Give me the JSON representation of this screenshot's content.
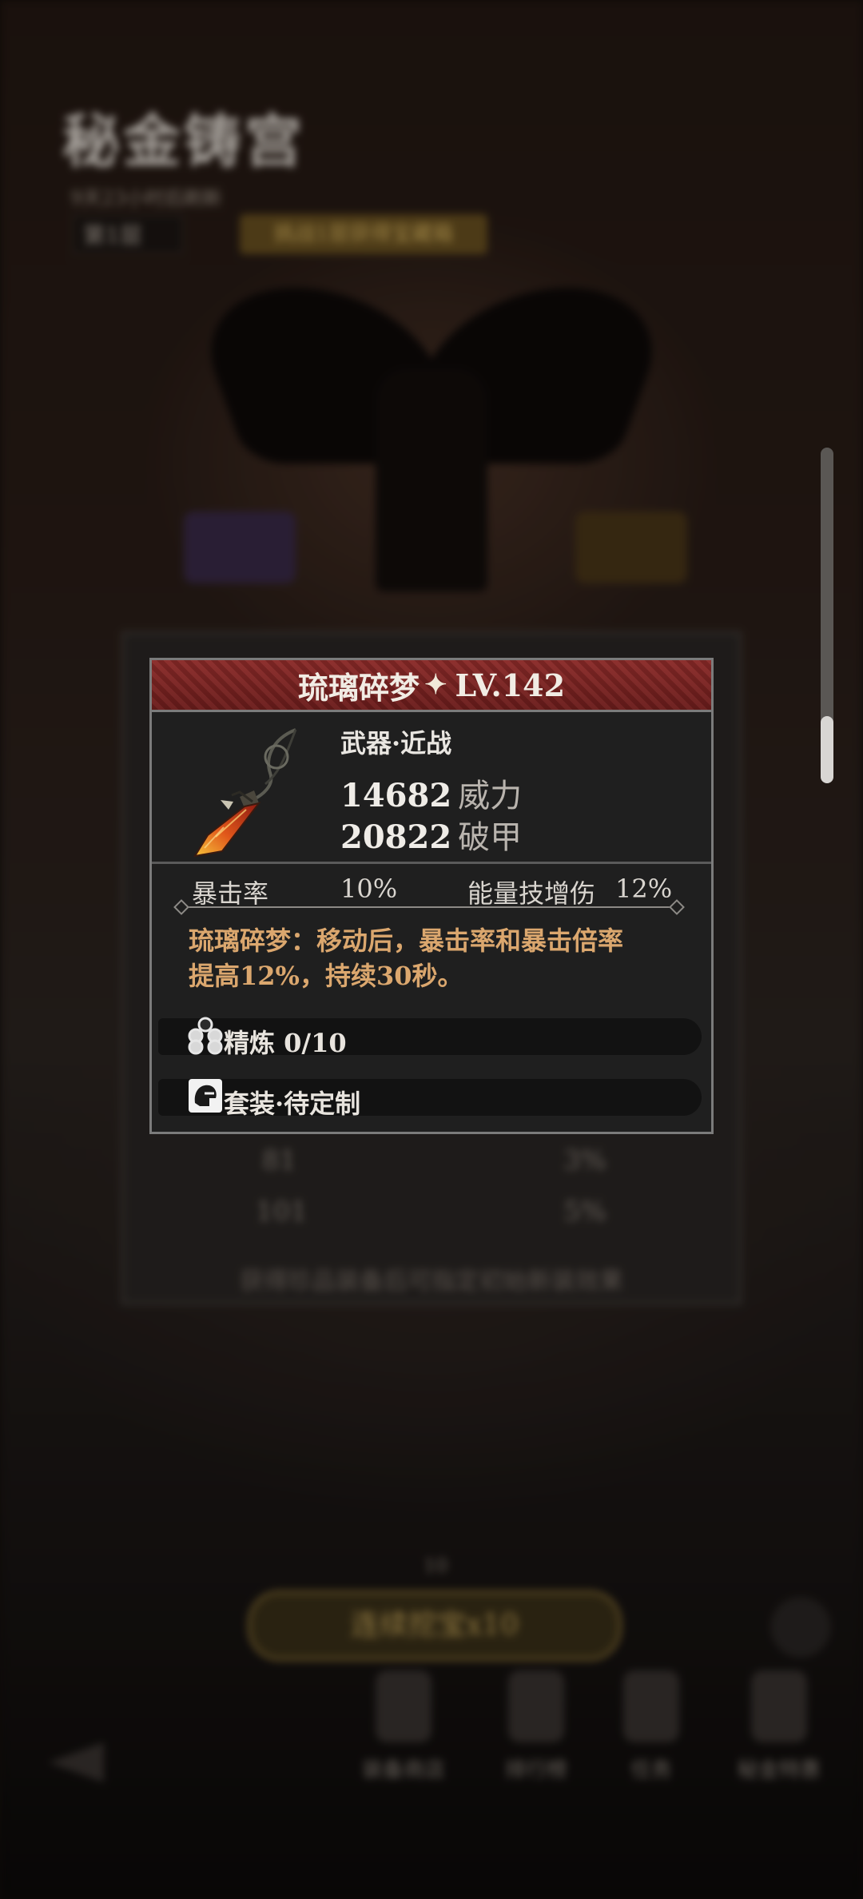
{
  "background": {
    "title": "秘金铸宫",
    "subtitle": "9天23小时后刷新",
    "floor": "第1层",
    "gold_tag": "挑战1层获得宝藏箱",
    "panel_rows": [
      {
        "left": "81",
        "right": "3%"
      },
      {
        "left": "101",
        "right": "5%"
      }
    ],
    "footnote": "获得珍品装备后可指定初始新装效果",
    "counter": "10",
    "gold_button": "连续挖宝x10",
    "nav": [
      "装备商店",
      "排行榜",
      "任务",
      "秘金特惠"
    ]
  },
  "item": {
    "name": "琉璃碎梦",
    "level": "LV.142",
    "type": "武器·近战",
    "stats": [
      {
        "value": "14682",
        "label": "威力"
      },
      {
        "value": "20822",
        "label": "破甲"
      }
    ],
    "crit_label": "暴击率",
    "crit_value": "10%",
    "energy_label": "能量技增伤",
    "energy_value": "12%",
    "effect_line1": "琉璃碎梦：移动后，暴击率和暴击倍率",
    "effect_line2": "提高12%，持续30秒。",
    "refine_label": "精炼 0/10",
    "set_label": "套装·待定制"
  },
  "colors": {
    "header_red": "#7c2422",
    "effect_text": "#dba76e",
    "card_bg": "#1f1f1f"
  },
  "icons": {
    "title_spark": "four-point-star-icon",
    "refine": "refine-cluster-icon",
    "set": "set-helmet-icon"
  }
}
